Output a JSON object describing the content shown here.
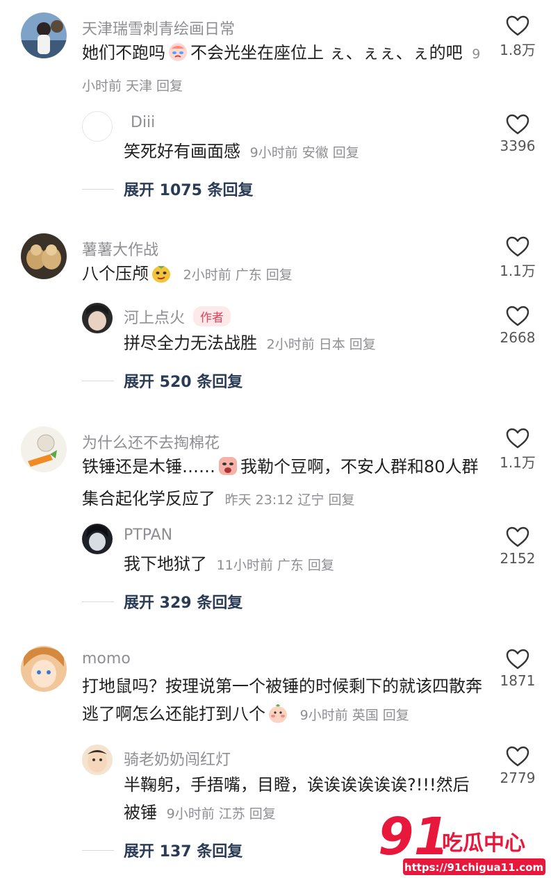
{
  "comments": [
    {
      "username": "天津瑞雪刺青绘画日常",
      "text_a": "她们不跑吗",
      "text_b": "不会光坐在座位上 ぇ、ぇぇ、ぇ的吧",
      "time": "9小时前",
      "location": "天津",
      "reply_label": "回复",
      "likes": "1.8万",
      "reply": {
        "username": "Diii",
        "text": "笑死好有画面感",
        "time": "9小时前",
        "location": "安徽",
        "reply_label": "回复",
        "likes": "3396"
      },
      "expand": "展开 1075 条回复"
    },
    {
      "username": "薯薯大作战",
      "text_a": "八个压颅",
      "time": "2小时前",
      "location": "广东",
      "reply_label": "回复",
      "likes": "1.1万",
      "reply": {
        "username": "河上点火",
        "badge": "作者",
        "text": "拼尽全力无法战胜",
        "time": "2小时前",
        "location": "日本",
        "reply_label": "回复",
        "likes": "2668"
      },
      "expand": "展开 520 条回复"
    },
    {
      "username": "为什么还不去掏棉花",
      "text_a": "铁锤还是木锤……",
      "text_b": "我勒个豆啊，不安人群和80人群集合起化学反应了",
      "time": "昨天 23:12",
      "location": "辽宁",
      "reply_label": "回复",
      "likes": "1.1万",
      "reply": {
        "username": "PTPAN",
        "text": "我下地狱了",
        "time": "11小时前",
        "location": "广东",
        "reply_label": "回复",
        "likes": "2152"
      },
      "expand": "展开 329 条回复"
    },
    {
      "username": "momo",
      "text_a": "打地鼠吗？按理说第一个被锤的时候剩下的就该四散奔逃了啊怎么还能打到八个",
      "time": "9小时前",
      "location": "英国",
      "reply_label": "回复",
      "likes": "1871",
      "reply": {
        "username": "骑老奶奶闯红灯",
        "text": "半鞠躬，手捂嘴，目瞪，诶诶诶诶诶诶?!!!然后被锤",
        "time": "9小时前",
        "location": "江苏",
        "reply_label": "回复",
        "likes": "2779"
      },
      "expand": "展开 137 条回复"
    }
  ],
  "watermark": {
    "logo": "91吃瓜中心",
    "url": "https://91chigua11.com"
  },
  "colors": {
    "meta": "#8e8e93",
    "expand": "#2a3b55",
    "badge": "#e0445a",
    "watermark": "#e8173c"
  }
}
